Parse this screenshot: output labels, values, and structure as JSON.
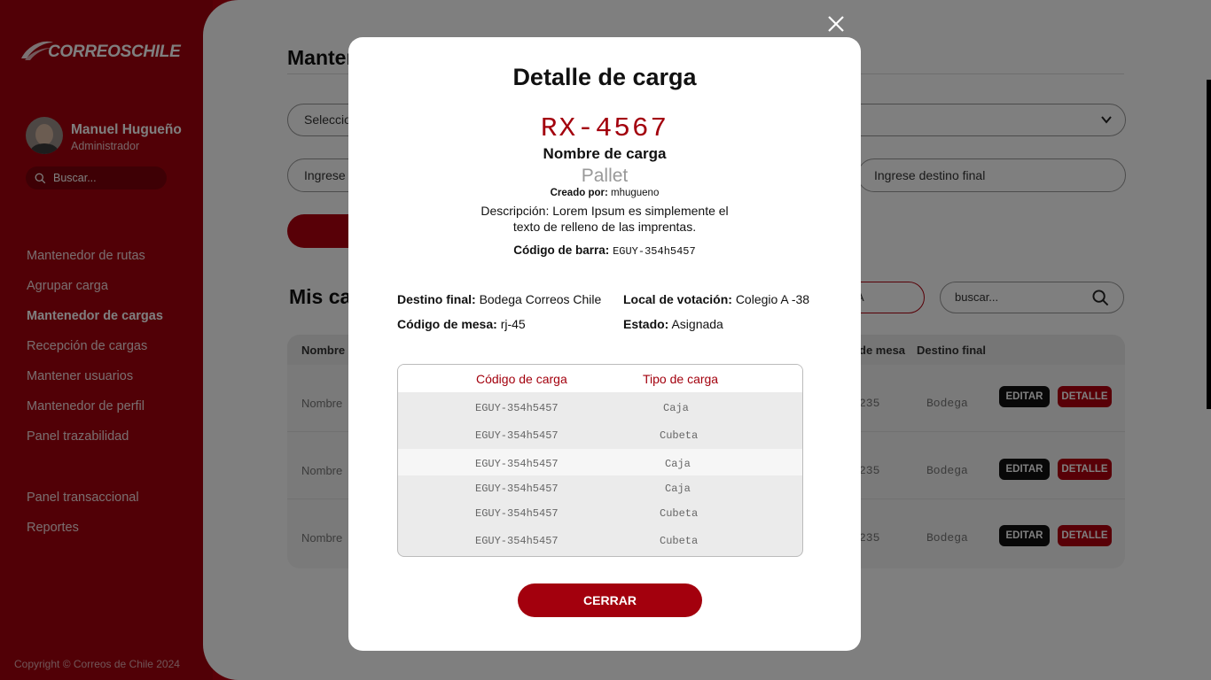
{
  "sidebar": {
    "logo_text": "CORREOSCHILE",
    "user_name": "Manuel Hugueño",
    "user_role": "Administrador",
    "search_placeholder": "Buscar...",
    "nav_group1": [
      "Mantenedor de rutas",
      "Agrupar carga",
      "Mantenedor de cargas",
      "Recepción de cargas",
      "Mantener usuarios",
      "Mantenedor de perfil",
      "Panel trazabilidad"
    ],
    "active_item": "Mantenedor de cargas",
    "nav_group2": [
      "Panel transaccional",
      "Reportes"
    ],
    "copyright": "Copyright © Correos de Chile 2024"
  },
  "main": {
    "title": "Mantenedor de cargas",
    "select_placeholder": "Seleccione",
    "input_left_placeholder": "Ingrese",
    "input_right_placeholder": "Ingrese destino final",
    "section_title": "Mis cargas",
    "filter_label": "A",
    "search_placeholder": "buscar...",
    "table_headers": [
      "Nombre",
      "de mesa",
      "Destino final"
    ],
    "rows": [
      {
        "name": "Nombre",
        "mesa": "235",
        "destino": "Bodega"
      },
      {
        "name": "Nombre",
        "mesa": "235",
        "destino": "Bodega"
      },
      {
        "name": "Nombre",
        "mesa": "235",
        "destino": "Bodega"
      }
    ],
    "edit_label": "EDITAR",
    "detail_label": "DETALLE"
  },
  "modal": {
    "title": "Detalle de carga",
    "code": "RX-4567",
    "name": "Nombre de carga",
    "type": "Pallet",
    "created_label": "Creado por:",
    "created_by": "mhugueno",
    "description": "Descripción: Lorem Ipsum es simplemente el texto de relleno de las imprentas.",
    "barcode_label": "Código de barra:",
    "barcode": "EGUY-354h5457",
    "destino_label": "Destino final:",
    "destino": "Bodega Correos Chile",
    "local_label": "Local de votación:",
    "local": "Colegio A -38",
    "mesa_label": "Código de mesa:",
    "mesa": "rj-45",
    "estado_label": "Estado:",
    "estado": "Asignada",
    "items_headers": [
      "Código de carga",
      "Tipo de carga"
    ],
    "items": [
      {
        "code": "EGUY-354h5457",
        "type": "Caja"
      },
      {
        "code": "EGUY-354h5457",
        "type": "Cubeta"
      },
      {
        "code": "EGUY-354h5457",
        "type": "Caja"
      },
      {
        "code": "EGUY-354h5457",
        "type": "Caja"
      },
      {
        "code": "EGUY-354h5457",
        "type": "Cubeta"
      },
      {
        "code": "EGUY-354h5457",
        "type": "Cubeta"
      }
    ],
    "close_button": "CERRAR"
  },
  "colors": {
    "brand_red": "#a3000d",
    "overlay": "rgba(0,0,0,0.5)"
  },
  "icons": [
    "correos-logo-icon",
    "search-icon",
    "chevron-down-icon",
    "close-icon"
  ]
}
